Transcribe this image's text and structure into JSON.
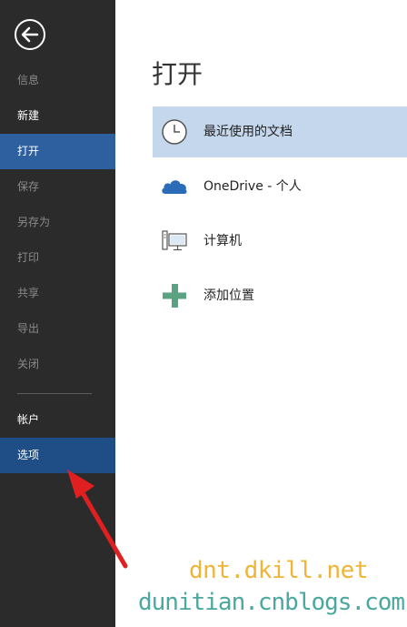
{
  "sidebar": {
    "items": [
      {
        "label": "信息"
      },
      {
        "label": "新建"
      },
      {
        "label": "打开"
      },
      {
        "label": "保存"
      },
      {
        "label": "另存为"
      },
      {
        "label": "打印"
      },
      {
        "label": "共享"
      },
      {
        "label": "导出"
      },
      {
        "label": "关闭"
      },
      {
        "label": "帐户"
      },
      {
        "label": "选项"
      }
    ]
  },
  "main": {
    "title": "打开",
    "locations": [
      {
        "label": "最近使用的文档",
        "icon": "clock-icon"
      },
      {
        "label": "OneDrive - 个人",
        "icon": "cloud-icon"
      },
      {
        "label": "计算机",
        "icon": "computer-icon"
      },
      {
        "label": "添加位置",
        "icon": "plus-icon"
      }
    ]
  },
  "watermark": {
    "line1": "dnt.dkill.net",
    "line2": "dunitian.cnblogs.com"
  },
  "colors": {
    "sidebar_bg": "#2b2b2b",
    "selected_nav": "#2e5f9f",
    "selected_location": "#c5d7ec",
    "arrow": "#e02020"
  }
}
